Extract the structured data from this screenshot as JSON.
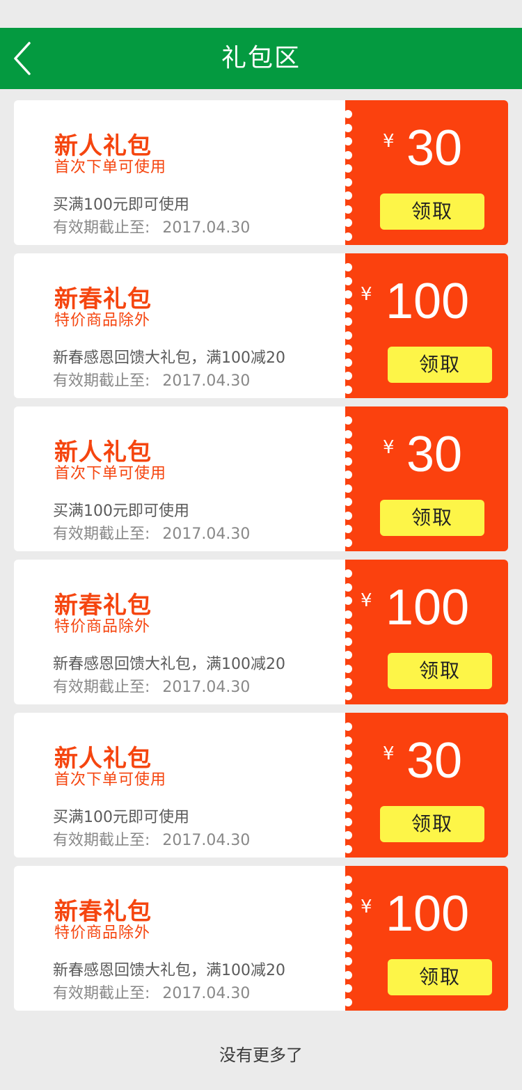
{
  "header": {
    "title": "礼包区",
    "back_icon": "chevron-left-icon"
  },
  "colors": {
    "header": "#049a40",
    "coupon_red": "#fb410e",
    "button_yellow": "#fdf548",
    "title_orange": "#f5450f"
  },
  "coupons": [
    {
      "title": "新人礼包",
      "subtitle": "首次下单可使用",
      "desc": "买满100元即可使用",
      "valid_label": "有效期截止至:",
      "valid_date": "2017.04.30",
      "currency": "¥",
      "amount": "30",
      "button": "领取"
    },
    {
      "title": "新春礼包",
      "subtitle": "特价商品除外",
      "desc": "新春感恩回馈大礼包，满100减20",
      "valid_label": "有效期截止至:",
      "valid_date": "2017.04.30",
      "currency": "¥",
      "amount": "100",
      "button": "领取"
    },
    {
      "title": "新人礼包",
      "subtitle": "首次下单可使用",
      "desc": "买满100元即可使用",
      "valid_label": "有效期截止至:",
      "valid_date": "2017.04.30",
      "currency": "¥",
      "amount": "30",
      "button": "领取"
    },
    {
      "title": "新春礼包",
      "subtitle": "特价商品除外",
      "desc": "新春感恩回馈大礼包，满100减20",
      "valid_label": "有效期截止至:",
      "valid_date": "2017.04.30",
      "currency": "¥",
      "amount": "100",
      "button": "领取"
    },
    {
      "title": "新人礼包",
      "subtitle": "首次下单可使用",
      "desc": "买满100元即可使用",
      "valid_label": "有效期截止至:",
      "valid_date": "2017.04.30",
      "currency": "¥",
      "amount": "30",
      "button": "领取"
    },
    {
      "title": "新春礼包",
      "subtitle": "特价商品除外",
      "desc": "新春感恩回馈大礼包，满100减20",
      "valid_label": "有效期截止至:",
      "valid_date": "2017.04.30",
      "currency": "¥",
      "amount": "100",
      "button": "领取"
    }
  ],
  "footer": {
    "note": "没有更多了"
  }
}
